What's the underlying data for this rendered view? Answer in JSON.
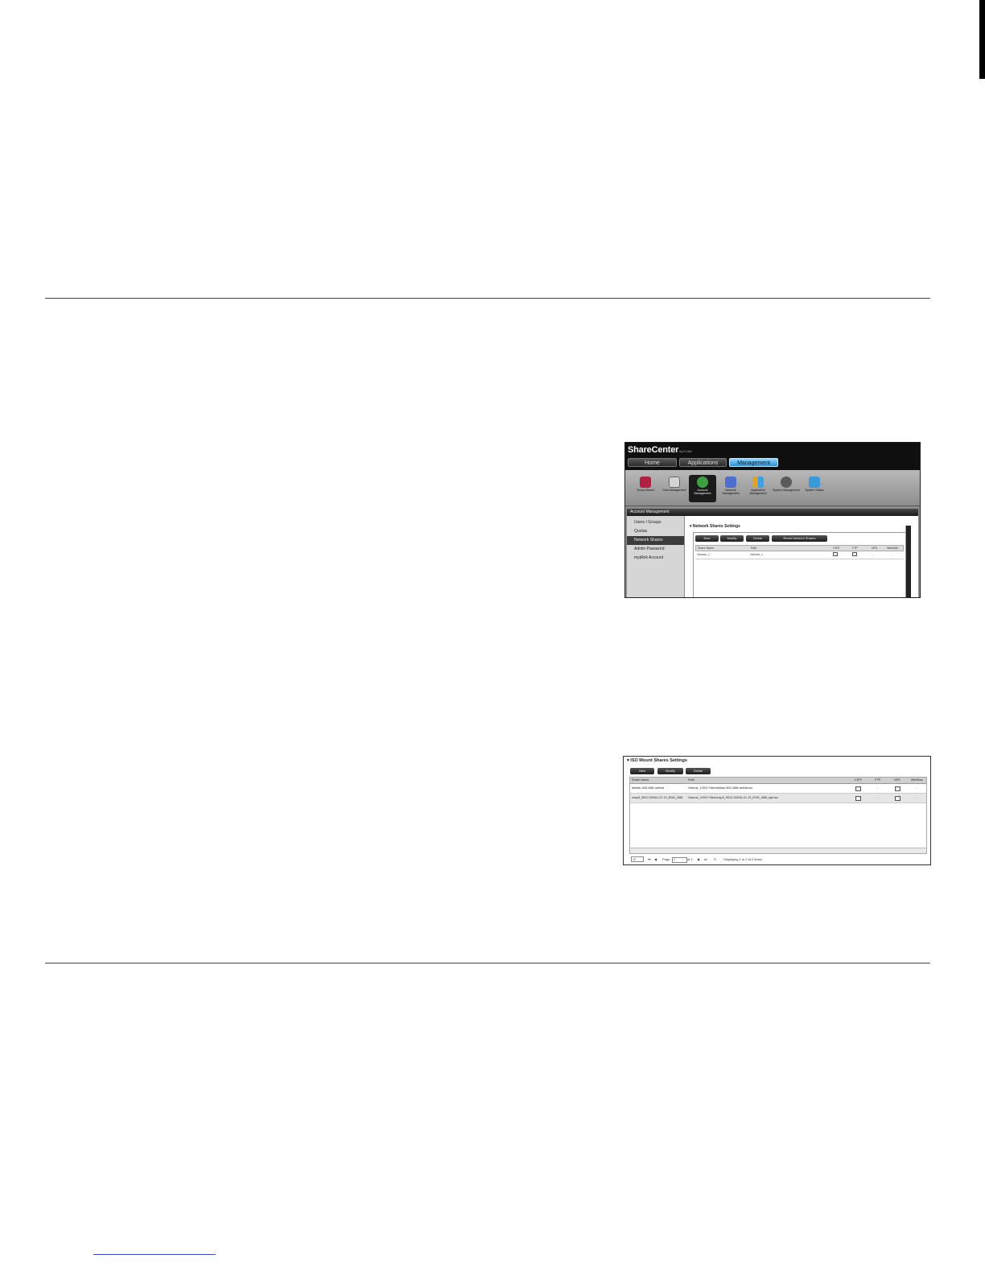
{
  "sharecenter": {
    "logo": "ShareCenter",
    "logo_sub": "by D-Link",
    "tabs": [
      "Home",
      "Applications",
      "Management"
    ],
    "active_tab": "Management",
    "icons": [
      {
        "label": "Setup Wizard",
        "color": "#b02040"
      },
      {
        "label": "Disk Management",
        "color": "#c0c0c0"
      },
      {
        "label": "Account Management",
        "color": "#3fa043"
      },
      {
        "label": "Network Management",
        "color": "#4c6fd0"
      },
      {
        "label": "Application Management",
        "color": "#e0a030"
      },
      {
        "label": "System Management",
        "color": "#606060"
      },
      {
        "label": "System Status",
        "color": "#3a9ad9"
      }
    ],
    "panel_header": "Account Management",
    "sidebar": [
      "Users / Groups",
      "Quotas",
      "Network Shares",
      "Admin Password",
      "mydlink Account"
    ],
    "selected_sidebar": "Network Shares",
    "section_title": "Network Shares Settings",
    "buttons": [
      "New",
      "Modify",
      "Delete",
      "Reset Network Shares"
    ],
    "columns": [
      "Share Name",
      "Path",
      "CIFS",
      "FTP",
      "NFS",
      "WebDAV"
    ],
    "rows": [
      {
        "share": "Volume_1",
        "path": "Volume_1",
        "nfs": "-",
        "webdav": "-"
      }
    ]
  },
  "iso": {
    "title": "ISO Mount Shares Settings",
    "buttons": [
      "New",
      "Modify",
      "Delete"
    ],
    "columns": [
      "Share Name",
      "Path",
      "CIFS",
      "FTP",
      "NFS",
      "WebDav"
    ],
    "rows": [
      {
        "share": "debian-500-i386-netinst",
        "path": "Volume_1/ISO Files/debian-500-i386-netinst.iso",
        "ftp": "-",
        "webdav": "-"
      },
      {
        "share": "sosp3_5512.0004U-21.12_ENG_i386",
        "path": "Volume_1/ISO Files/sosp3_5512.0004U-21.12_ENG_i386_spk.iso",
        "ftp": "-",
        "webdav": "-"
      }
    ],
    "pager": {
      "page_size": "10",
      "page_label": "Page",
      "page_value": "1",
      "of_label": "of 1",
      "display": "Displaying 1 to 2 of 2 items"
    }
  }
}
